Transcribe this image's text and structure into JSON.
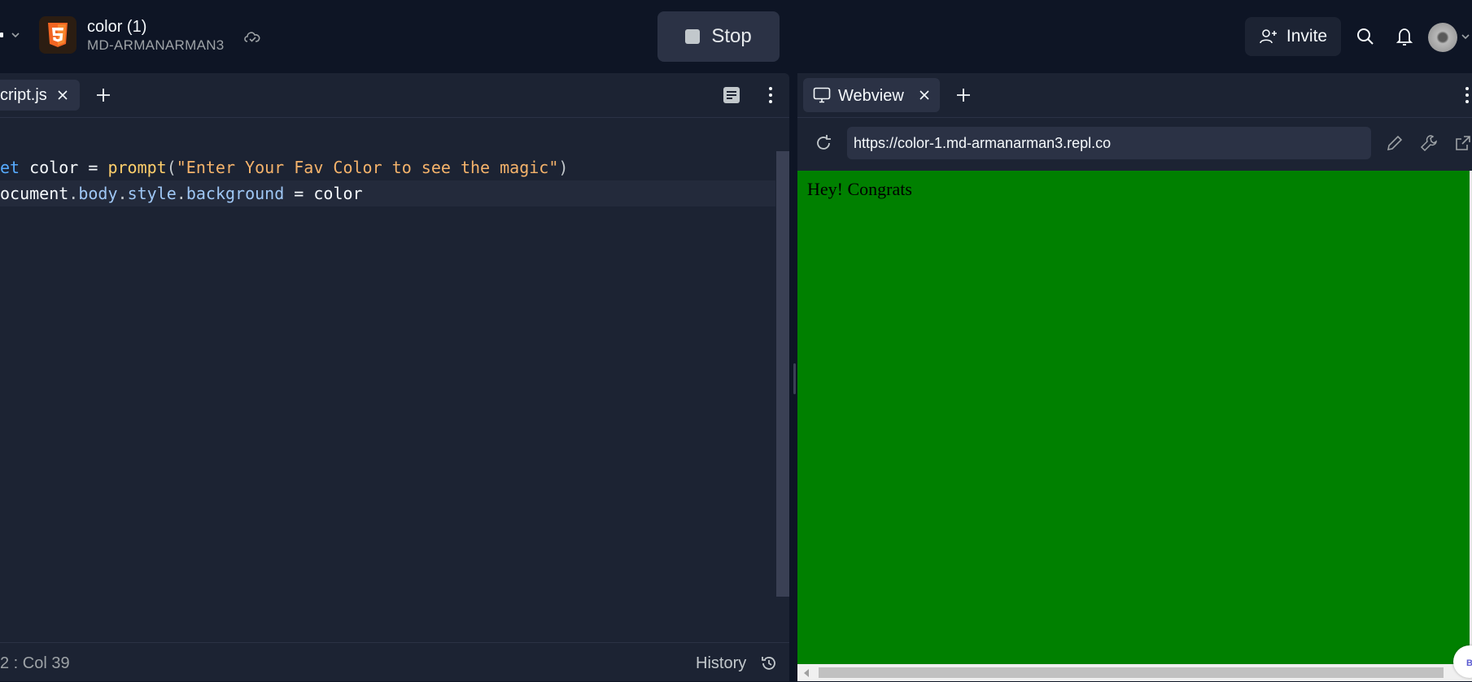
{
  "header": {
    "project_title": "color (1)",
    "project_owner": "MD-ARMANARMAN3",
    "project_icon": "html5-icon",
    "stop_label": "Stop",
    "invite_label": "Invite"
  },
  "editor": {
    "file_tab_label": "cript.js",
    "code_lines": [
      [
        "et",
        " color = ",
        "prompt",
        "(",
        "\"Enter Your Fav Color to see the magic\"",
        ")"
      ],
      [
        "ocument",
        ".",
        "body",
        ".",
        "style",
        ".",
        "background",
        " = color"
      ]
    ],
    "status_position": "2 : Col 39",
    "history_label": "History"
  },
  "webview": {
    "tab_label": "Webview",
    "url": "https://color-1.md-armanarman3.repl.co",
    "page_text": "Hey! Congrats",
    "page_background": "#008000",
    "badge_text": "B"
  },
  "colors": {
    "app_bg": "#0e1525",
    "panel_bg": "#1c2333",
    "accent_orange": "#f26522",
    "keyword_blue": "#57abff"
  }
}
